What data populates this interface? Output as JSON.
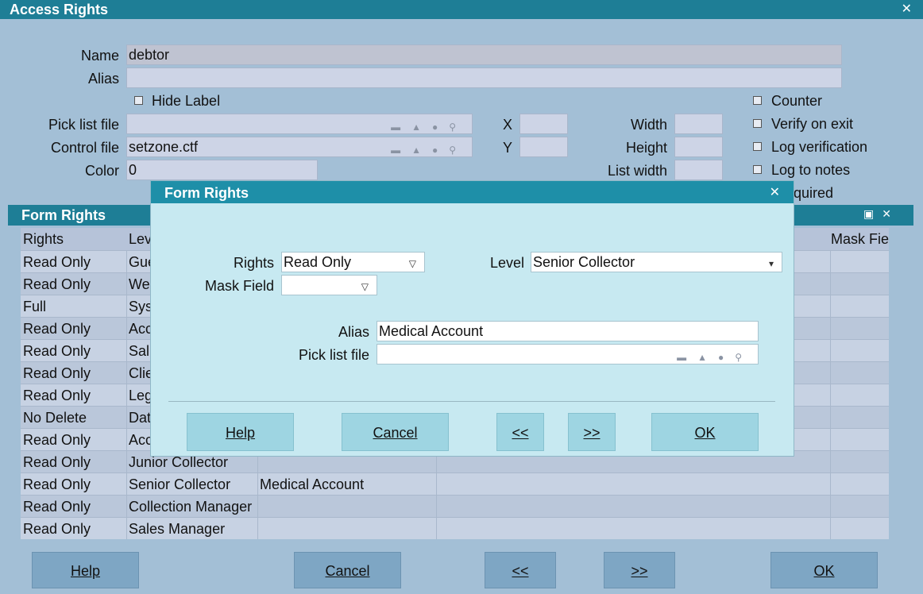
{
  "window": {
    "title": "Access Rights",
    "close_glyph": "✕"
  },
  "form": {
    "name_label": "Name",
    "name_value": "debtor",
    "alias_label": "Alias",
    "alias_value": "",
    "hide_label": "Hide Label",
    "picklist_label": "Pick list file",
    "picklist_value": "",
    "control_label": "Control file",
    "control_value": "setzone.ctf",
    "color_label": "Color",
    "color_value": "0",
    "x_label": "X",
    "x_value": "",
    "y_label": "Y",
    "y_value": "",
    "width_label": "Width",
    "width_value": "",
    "height_label": "Height",
    "height_value": "",
    "listwidth_label": "List width",
    "listwidth_value": "",
    "checks": {
      "counter": "Counter",
      "verify": "Verify on exit",
      "logver": "Log verification",
      "lognotes": "Log to notes",
      "required_partial": "quired"
    }
  },
  "form_rights_panel": {
    "title": "Form Rights",
    "columns": {
      "rights": "Rights",
      "level": "Lev",
      "mask": "Mask Fie"
    },
    "rows": [
      {
        "rights": "Read Only",
        "level": "Gue",
        "alias": ""
      },
      {
        "rights": "Read Only",
        "level": "We",
        "alias": ""
      },
      {
        "rights": "Full",
        "level": "Sys",
        "alias": ""
      },
      {
        "rights": "Read Only",
        "level": "Acc",
        "alias": ""
      },
      {
        "rights": "Read Only",
        "level": "Sal",
        "alias": ""
      },
      {
        "rights": "Read Only",
        "level": "Clie",
        "alias": ""
      },
      {
        "rights": "Read Only",
        "level": "Leg",
        "alias": ""
      },
      {
        "rights": "No Delete",
        "level": "Dat",
        "alias": ""
      },
      {
        "rights": "Read Only",
        "level": "Acc",
        "alias": ""
      },
      {
        "rights": "Read Only",
        "level": "Junior Collector",
        "alias": ""
      },
      {
        "rights": "Read Only",
        "level": "Senior Collector",
        "alias": "Medical Account"
      },
      {
        "rights": "Read Only",
        "level": "Collection Manager",
        "alias": ""
      },
      {
        "rights": "Read Only",
        "level": "Sales Manager",
        "alias": ""
      }
    ]
  },
  "bottom_buttons": {
    "help": "Help",
    "cancel": "Cancel",
    "prev": "<<",
    "next": ">>",
    "ok": "OK"
  },
  "dialog": {
    "title": "Form Rights",
    "close_glyph": "✕",
    "rights_label": "Rights",
    "rights_value": "Read Only",
    "level_label": "Level",
    "level_value": "Senior Collector",
    "mask_label": "Mask Field",
    "mask_value": "",
    "alias_label": "Alias",
    "alias_value": "Medical Account",
    "picklist_label": "Pick list file",
    "picklist_value": "",
    "buttons": {
      "help": "Help",
      "cancel": "Cancel",
      "prev": "<<",
      "next": ">>",
      "ok": "OK"
    }
  }
}
